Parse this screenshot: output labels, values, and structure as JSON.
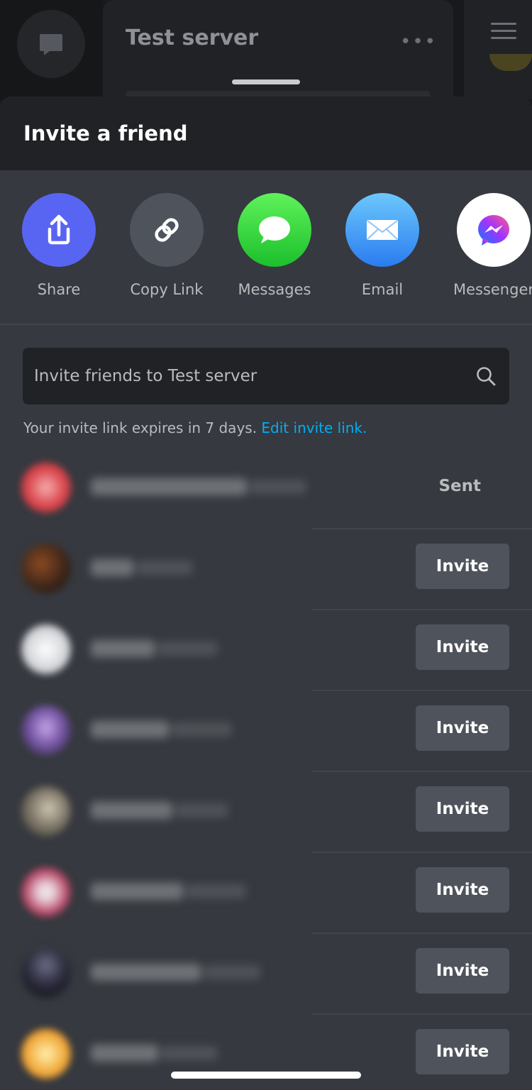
{
  "background": {
    "server_title": "Test server",
    "more_icon": "ellipsis-icon",
    "dm_icon": "chat-bubble-icon",
    "menu_icon": "hamburger-icon"
  },
  "sheet": {
    "title": "Invite a friend"
  },
  "share_targets": [
    {
      "label": "Share",
      "icon": "share-upload-icon",
      "color": "#5865f2"
    },
    {
      "label": "Copy Link",
      "icon": "link-icon",
      "color": "#4f545c"
    },
    {
      "label": "Messages",
      "icon": "messages-icon",
      "color": "#34c759"
    },
    {
      "label": "Email",
      "icon": "mail-icon",
      "color": "#3d8ef7"
    },
    {
      "label": "Messenger",
      "icon": "messenger-icon",
      "color": "#ffffff"
    }
  ],
  "search": {
    "placeholder": "Invite friends to Test server",
    "icon": "search-icon"
  },
  "expiry": {
    "text": "Your invite link expires in 7 days.",
    "link": "Edit invite link."
  },
  "friends": [
    {
      "avatar_color": "#d9434a",
      "action": "Sent"
    },
    {
      "avatar_color": "#5a3a22",
      "action": "Invite"
    },
    {
      "avatar_color": "#c9cbd0",
      "action": "Invite"
    },
    {
      "avatar_color": "#7a5aa8",
      "action": "Invite"
    },
    {
      "avatar_color": "#7b7466",
      "action": "Invite"
    },
    {
      "avatar_color": "#b84a6a",
      "action": "Invite"
    },
    {
      "avatar_color": "#2a2a3a",
      "action": "Invite"
    },
    {
      "avatar_color": "#f2a93b",
      "action": "Invite"
    }
  ]
}
